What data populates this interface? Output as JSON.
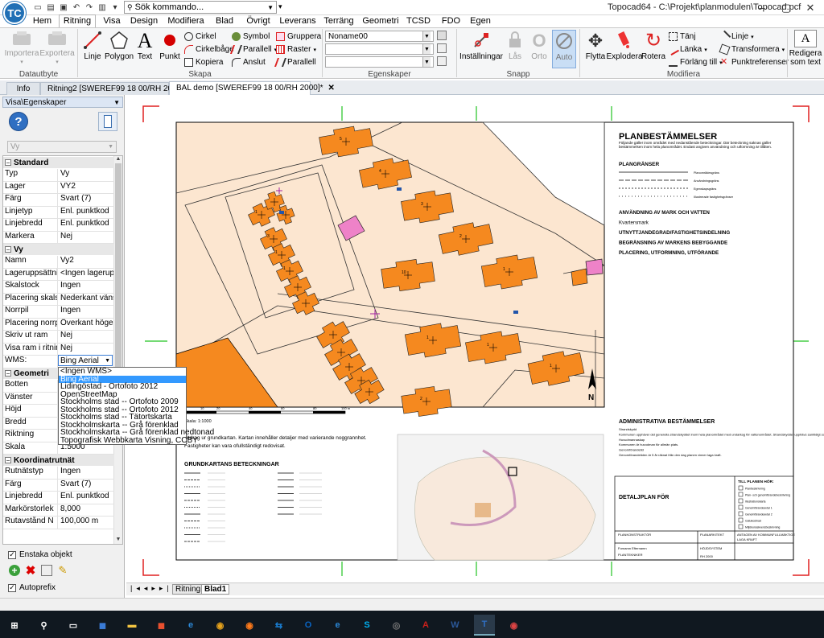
{
  "titlebar": {
    "app_logo": "TC",
    "command_placeholder": "Sök kommando...",
    "window_title": "Topocad64 - C:\\Projekt\\planmodulen\\Topocad.pcf"
  },
  "menu": [
    "Hem",
    "Ritning",
    "Visa",
    "Design",
    "Modifiera",
    "Blad",
    "Övrigt",
    "Leverans",
    "Terräng",
    "Geometri",
    "TCSD",
    "FDO",
    "Egen"
  ],
  "ribbon": {
    "datautbyte": {
      "label": "Datautbyte",
      "buttons": [
        "Importera",
        "Exportera"
      ]
    },
    "skapa": {
      "label": "Skapa",
      "big": [
        "Linje",
        "Polygon",
        "Text",
        "Punkt"
      ],
      "col1": [
        "Cirkel",
        "Cirkelbåge",
        "Kopiera"
      ],
      "col2": [
        "Symbol",
        "Parallell",
        "Anslut"
      ],
      "col3": [
        "Gruppera",
        "Raster",
        "Parallell"
      ]
    },
    "egenskaper": {
      "label": "Egenskaper",
      "combo1": "Noname00"
    },
    "snapp": {
      "label": "Snapp",
      "buttons": [
        "Inställningar",
        "Lås",
        "Orto",
        "Auto"
      ]
    },
    "modifiera": {
      "label": "Modifiera",
      "big": [
        "Flytta",
        "Explodera",
        "Rotera"
      ],
      "col1": [
        "Tänj",
        "Länka",
        "Förläng till"
      ],
      "col2": [
        "Linje",
        "Transformera",
        "Punktreferenser"
      ]
    },
    "text": {
      "button": "Redigera som text"
    }
  },
  "doc_tabs": [
    "Info",
    "Ritning2 [SWEREF99 18 00/RH 2000]*",
    "BAL demo [SWEREF99 18 00/RH 2000]*"
  ],
  "panel": {
    "header": "Visa\\Egenskaper",
    "vy_combo": "Vy",
    "sections": {
      "standard": "Standard",
      "vy": "Vy",
      "geometri": "Geometri",
      "koordinat": "Koordinatrutnät"
    },
    "standard_rows": [
      [
        "Typ",
        "Vy"
      ],
      [
        "Lager",
        "VY2"
      ],
      [
        "Färg",
        "Svart (7)"
      ],
      [
        "Linjetyp",
        "Enl. punktkod"
      ],
      [
        "Linjebredd",
        "Enl. punktkod"
      ],
      [
        "Markera",
        "Nej"
      ]
    ],
    "vy_rows": [
      [
        "Namn",
        "Vy2"
      ],
      [
        "Lageruppsättning",
        "<Ingen lageruppsä"
      ],
      [
        "Skalstock",
        "Ingen"
      ],
      [
        "Placering skalstock",
        "Nederkant vänster"
      ],
      [
        "Norrpil",
        "Ingen"
      ],
      [
        "Placering norrpil",
        "Överkant höger"
      ],
      [
        "Skriv ut ram",
        "Nej"
      ],
      [
        "Visa ram i ritningsv",
        "Nej"
      ],
      [
        "WMS:",
        "Bing Aerial"
      ]
    ],
    "geometri_rows": [
      [
        "Botten",
        ""
      ],
      [
        "Vänster",
        ""
      ],
      [
        "Höjd",
        ""
      ],
      [
        "Bredd",
        ""
      ],
      [
        "Riktning",
        ""
      ],
      [
        "Skala",
        "1:5000"
      ]
    ],
    "koord_rows": [
      [
        "Rutnätstyp",
        "Ingen"
      ],
      [
        "Färg",
        "Svart (7)"
      ],
      [
        "Linjebredd",
        "Enl. punktkod"
      ],
      [
        "Markörstorlek",
        "8,000"
      ],
      [
        "Rutavstånd N",
        "100,000 m"
      ]
    ],
    "wms_options": [
      "<Ingen WMS>",
      "Bing Aerial",
      "Lidingöstad - Ortofoto 2012",
      "OpenStreetMap",
      "Stockholms stad -- Ortofoto 2009",
      "Stockholms stad -- Ortofoto 2012",
      "Stockholms stad -- Tätortskarta",
      "Stockholmskarta -- Grå förenklad",
      "Stockholmskarta -- Grå förenklad nedtonad",
      "Topografisk Webbkarta Visning, CCBY"
    ],
    "enstaka_objekt": "Enstaka objekt",
    "autoprefix": "Autoprefix"
  },
  "drawing": {
    "title": "PLANBESTÄMMELSER",
    "subtitle": "Följande gäller inom området med nedanstående beteckningar. Där beteckning saknas gäller bestämmelsen inom hela planområdet. Endast angiven användning och utformning är tillåten.",
    "plangranser": "PLANGRÄNSER",
    "plangranser_items": [
      "Planområdesgräns",
      "Användningsgräns",
      "Egenskapsgräns",
      "Illustrerade fastighetsgränser"
    ],
    "headings": [
      "ANVÄNDNING AV MARK OCH VATTEN",
      "Kvartersmark",
      "UTNYTTJANDEGRAD/FASTIGHETSINDELNING",
      "BEGRÄNSNING AV MARKENS BEBYGGANDE",
      "PLACERING, UTFORMNING, UTFÖRANDE"
    ],
    "admin": "ADMINISTRATIVA BESTÄMMELSER",
    "admin_lines": [
      "Strandskydd",
      "Kommunen upphäver det generella strandskyddet inom hela planområdet med undantag för vattenområdet. Strandskyddet upphävs samtidigt som detaljplanen vinner laga kraft.",
      "Huvudmannaskap",
      "Kommunen är huvudman för allmän plats.",
      "Genomförandetid",
      "Genomförandetiden är 5 år räknat från den dag planen vinner laga kraft."
    ],
    "detaljplan": "DETALJPLAN FÖR",
    "till_planen": "TILL PLANEN HÖR:",
    "till_items": [
      "Planbeskrivning",
      "Plan- och genomförandebeskrivning",
      "Illustrationskarta",
      "Genomförandeavtal 1",
      "Genomförandeavtal 2",
      "Gatukostnad",
      "Miljökonsekvensbeskrivning"
    ],
    "table_head": [
      "PLANKONSTRUKTÖR",
      "PLANARKITEKT",
      "ANTAGEN AV KOMMUNFULLMÄKTIGE",
      "LAGA KRAFT"
    ],
    "table_vals": [
      "Fornamn Efternamn",
      "PLANTEKNIKER",
      "HÖJDSYSTEM",
      "RH 2000"
    ],
    "scale_text": "Skala: 1:1000",
    "note_lines": [
      "Utdrag ur grundkartan. Kartan innehåller detaljer med varierande noggrannhet.",
      "Fastigheter kan vara ofullständigt redovisat."
    ],
    "grundkarta": "GRUNDKARTANS BETECKNINGAR",
    "scale_ticks": [
      "0",
      "10",
      "20",
      "40",
      "60",
      "80",
      "100 m"
    ],
    "north": "N",
    "lot_numbers": [
      "5",
      "4",
      "3",
      "2",
      "1",
      "10",
      "1",
      "1",
      "1",
      "1",
      "2",
      "3",
      "1",
      "1"
    ]
  },
  "sheet_tabs": [
    "Ritning",
    "Blad1"
  ],
  "taskbar_icons": [
    "windows-icon",
    "search-icon",
    "task-view-icon",
    "store-icon",
    "explorer-icon",
    "office-icon",
    "edge-icon",
    "chrome-icon",
    "firefox-icon",
    "teamviewer-icon",
    "outlook-icon",
    "ie-icon",
    "skype-icon",
    "app-icon",
    "acrobat-icon",
    "word-icon",
    "topocad-icon",
    "paint-icon"
  ],
  "colors": {
    "building": "#f5891f",
    "ground": "#fce6d0",
    "accent": "#1f6fb5",
    "highlight": "#ee82c8"
  }
}
